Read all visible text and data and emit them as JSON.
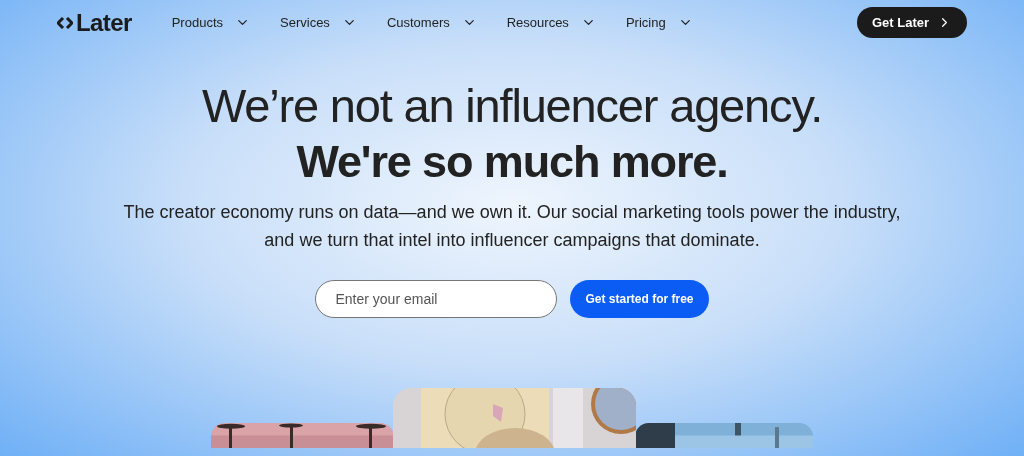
{
  "nav": {
    "logo": "Later",
    "items": [
      {
        "label": "Products"
      },
      {
        "label": "Services"
      },
      {
        "label": "Customers"
      },
      {
        "label": "Resources"
      },
      {
        "label": "Pricing"
      }
    ],
    "cta": "Get Later"
  },
  "hero": {
    "title": "We’re not an influencer agency.",
    "subtitle": "We're so much more.",
    "body": "The creator economy runs on data—and we own it. Our social marketing tools power the industry, and we turn that intel into influencer campaigns that dominate.",
    "email": {
      "placeholder": "Enter your email"
    },
    "button": "Get started for free"
  }
}
